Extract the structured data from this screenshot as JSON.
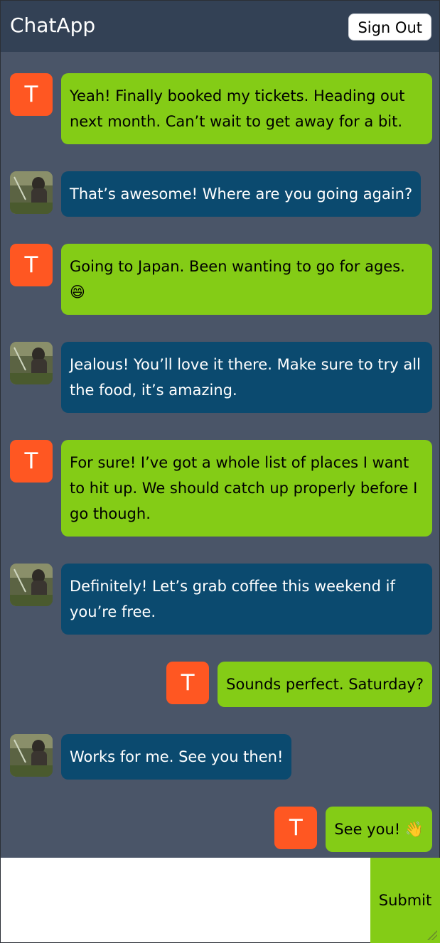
{
  "header": {
    "title": "ChatApp",
    "signout_label": "Sign Out"
  },
  "messages": [
    {
      "side": "left",
      "avatar": "T",
      "text": "Yeah! Finally booked my tickets. Heading out next month. Can’t wait to get away for a bit."
    },
    {
      "side": "left",
      "avatar": "photo",
      "text": "That’s awesome! Where are you going again?"
    },
    {
      "side": "left",
      "avatar": "T",
      "text": "Going to Japan. Been wanting to go for ages. 😄"
    },
    {
      "side": "left",
      "avatar": "photo",
      "text": "Jealous! You’ll love it there. Make sure to try all the food, it’s amazing."
    },
    {
      "side": "left",
      "avatar": "T",
      "text": "For sure! I’ve got a whole list of places I want to hit up. We should catch up properly before I go though."
    },
    {
      "side": "left",
      "avatar": "photo",
      "text": "Definitely! Let’s grab coffee this weekend if you’re free."
    },
    {
      "side": "right",
      "avatar": "T",
      "text": "Sounds perfect. Saturday?"
    },
    {
      "side": "left",
      "avatar": "photo",
      "text": "Works for me. See you then!"
    },
    {
      "side": "right",
      "avatar": "T",
      "text": "See you! 👋"
    }
  ],
  "composer": {
    "placeholder": "",
    "value": "",
    "submit_label": "Submit"
  },
  "colors": {
    "header_bg": "#334155",
    "chat_bg": "#4a5568",
    "own_bubble": "#84cc16",
    "other_bubble": "#0b4a6f",
    "avatar_letter_bg": "#ff5722"
  }
}
